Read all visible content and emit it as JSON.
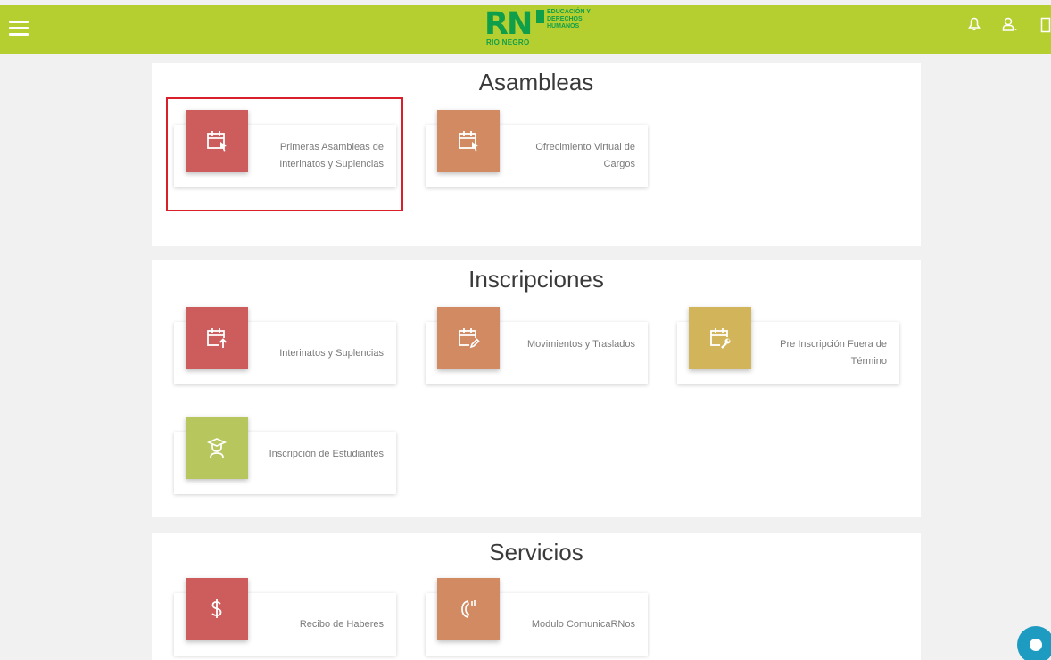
{
  "header": {
    "logo_letters": "RN",
    "logo_subtitle": "RIO NEGRO",
    "logo_text": "EDUCACIÓN Y DERECHOS HUMANOS",
    "icons": [
      "menu-icon",
      "bell-icon",
      "user-icon",
      "logout-icon"
    ]
  },
  "colors": {
    "topbar": "#b5cf31",
    "red": "#cd5c5c",
    "orange": "#d18a61",
    "gold": "#d2b55b",
    "lime": "#b7c75d",
    "highlight": "#d9202a"
  },
  "sections": [
    {
      "title": "Asambleas",
      "cards": [
        {
          "label": "Primeras Asambleas de Interinatos y Suplencias",
          "icon": "calendar-cursor-icon",
          "color": "red"
        },
        {
          "label": "Ofrecimiento Virtual de Cargos",
          "icon": "calendar-cursor-icon",
          "color": "orange"
        }
      ]
    },
    {
      "title": "Inscripciones",
      "cards": [
        {
          "label": "Interinatos y Suplencias",
          "icon": "calendar-upload-icon",
          "color": "red"
        },
        {
          "label": "Movimientos y Traslados",
          "icon": "calendar-edit-icon",
          "color": "orange"
        },
        {
          "label": "Pre Inscripción Fuera de Término",
          "icon": "calendar-wrench-icon",
          "color": "gold"
        },
        {
          "label": "Inscripción de Estudiantes",
          "icon": "graduate-icon",
          "color": "lime"
        }
      ]
    },
    {
      "title": "Servicios",
      "cards": [
        {
          "label": "Recibo de Haberes",
          "icon": "dollar-icon",
          "color": "red"
        },
        {
          "label": "Modulo ComunicaRNos",
          "icon": "phone-icon",
          "color": "orange"
        }
      ]
    }
  ]
}
